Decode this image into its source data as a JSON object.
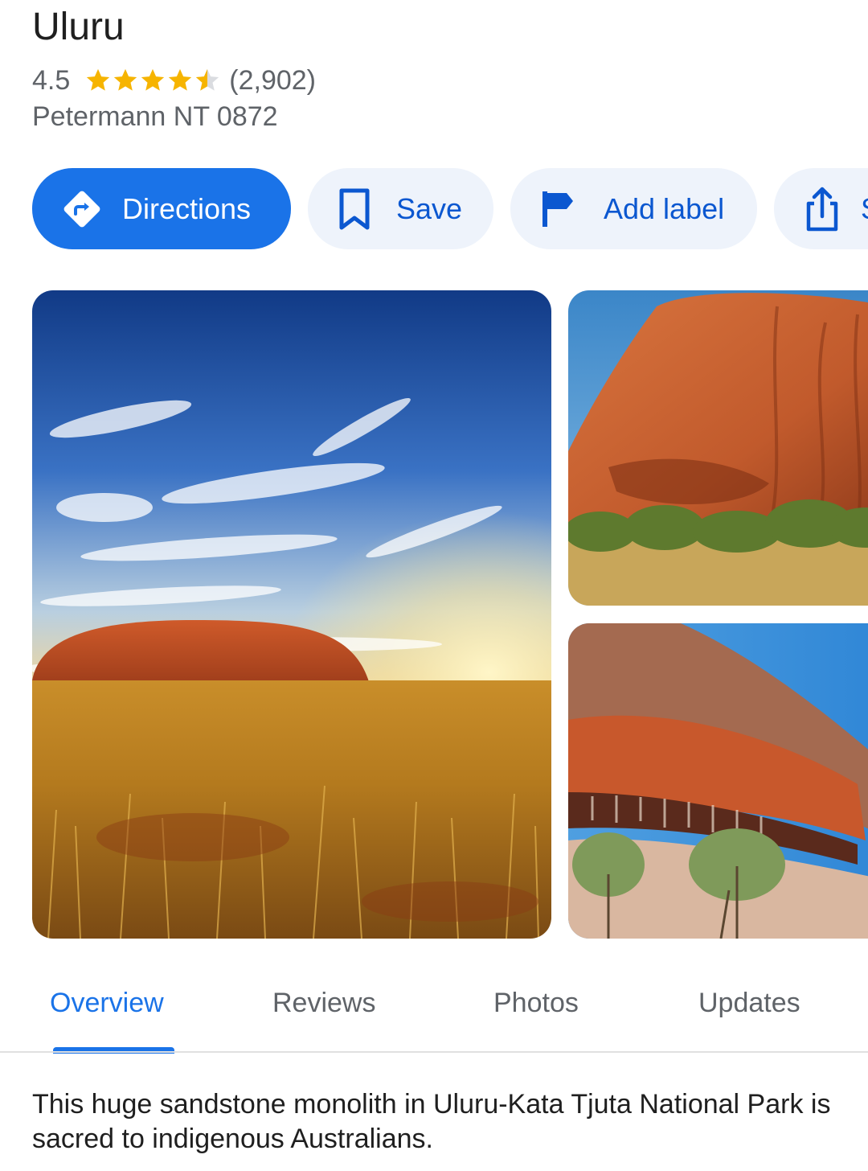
{
  "place": {
    "title": "Uluru",
    "rating": "4.5",
    "rating_stars_value": 4.5,
    "rating_stars_max": 5,
    "review_count": "(2,902)",
    "address": "Petermann NT 0872"
  },
  "actions": {
    "directions_label": "Directions",
    "save_label": "Save",
    "add_label_label": "Add label",
    "share_label": "S"
  },
  "photos": [
    {
      "icon": "uluru-landscape-photo"
    },
    {
      "icon": "rock-face-photo"
    },
    {
      "icon": "rock-overhang-photo"
    }
  ],
  "tabs": [
    {
      "label": "Overview",
      "active": true
    },
    {
      "label": "Reviews",
      "active": false
    },
    {
      "label": "Photos",
      "active": false
    },
    {
      "label": "Updates",
      "active": false
    }
  ],
  "description": "This huge sandstone monolith in Uluru-Kata Tjuta National Park is sacred to indigenous Australians.",
  "colors": {
    "accent": "#1a73e8",
    "star": "#f6b400",
    "chip_bg": "#eef3fb",
    "chip_text": "#0b57d0"
  }
}
